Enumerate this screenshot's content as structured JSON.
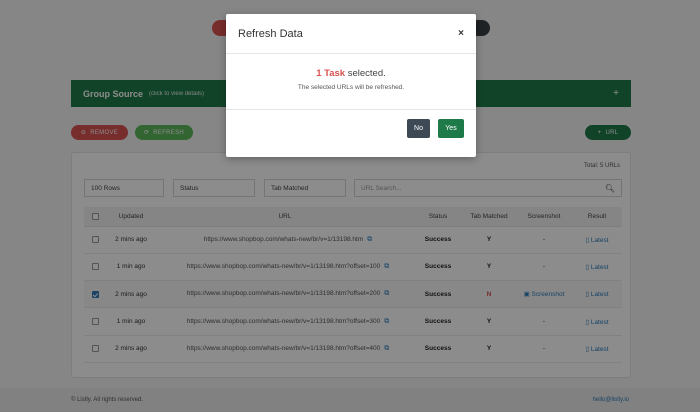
{
  "toolbar": {
    "remove_label": "REMOVE",
    "refresh_label": "REFRESH",
    "add_url_label": "URL"
  },
  "group": {
    "title": "Group Source",
    "hint": "(click to view details)",
    "expand": "+"
  },
  "summary": {
    "total": "Total: 5 URLs"
  },
  "filters": {
    "rows": "100 Rows",
    "status": "Status",
    "tab_matched": "Tab Matched",
    "search_placeholder": "URL Search..."
  },
  "table": {
    "headers": [
      "Updated",
      "URL",
      "Status",
      "Tab Matched",
      "Screenshot",
      "Result"
    ],
    "rows": [
      {
        "checked": false,
        "updated": "2 mins ago",
        "url": "https://www.shopbop.com/whats-new/br/v=1/13198.htm",
        "status": "Success",
        "tab": "Y",
        "screenshot": "-",
        "result": "Latest"
      },
      {
        "checked": false,
        "updated": "1 min ago",
        "url": "https://www.shopbop.com/whats-new/br/v=1/13198.htm?offset=100",
        "status": "Success",
        "tab": "Y",
        "screenshot": "-",
        "result": "Latest"
      },
      {
        "checked": true,
        "updated": "2 mins ago",
        "url": "https://www.shopbop.com/whats-new/br/v=1/13198.htm?offset=200",
        "status": "Success",
        "tab": "N",
        "screenshot": "Screenshot",
        "result": "Latest"
      },
      {
        "checked": false,
        "updated": "1 min ago",
        "url": "https://www.shopbop.com/whats-new/br/v=1/13198.htm?offset=300",
        "status": "Success",
        "tab": "Y",
        "screenshot": "-",
        "result": "Latest"
      },
      {
        "checked": false,
        "updated": "2 mins ago",
        "url": "https://www.shopbop.com/whats-new/br/v=1/13198.htm?offset=400",
        "status": "Success",
        "tab": "Y",
        "screenshot": "-",
        "result": "Latest"
      }
    ]
  },
  "footer": {
    "copyright": "© Listly. All rights reserved.",
    "email": "hello@listly.io"
  },
  "modal": {
    "title": "Refresh Data",
    "close": "×",
    "count": "1 Task",
    "selected_text": " selected.",
    "subtext": "The selected URLs will be refreshed.",
    "no_label": "No",
    "yes_label": "Yes"
  },
  "colors": {
    "brand_green": "#1f7a4a",
    "danger_red": "#d9534f",
    "refresh_green": "#5cb85c",
    "link_blue": "#2a7ab8"
  },
  "icons": {
    "remove": "minus-circle-icon",
    "refresh": "refresh-icon",
    "add_url": "plus-icon",
    "search": "search-icon",
    "external_link": "external-link-icon",
    "document": "document-icon",
    "image": "image-icon",
    "close": "close-icon"
  }
}
